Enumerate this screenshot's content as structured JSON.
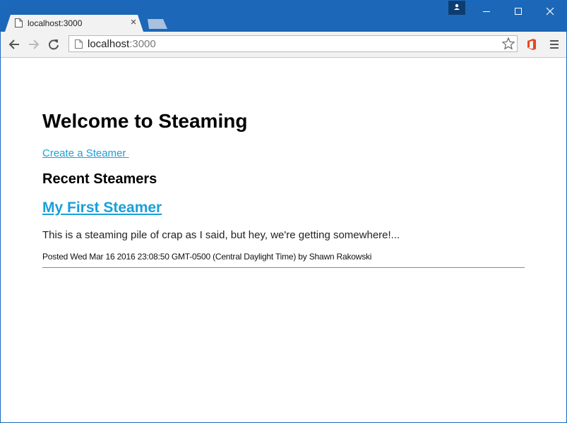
{
  "browser": {
    "tab_title": "localhost:3000",
    "tab_close": "×",
    "url_host": "localhost",
    "url_port": ":3000"
  },
  "page": {
    "title": "Welcome to Steaming",
    "create_link": "Create a Steamer ",
    "section_title": "Recent Steamers",
    "posts": [
      {
        "title": "My First Steamer",
        "body": "This is a steaming pile of crap as I said, but hey, we're getting somewhere!...",
        "meta": "Posted Wed Mar 16 2016 23:08:50 GMT-0500 (Central Daylight Time) by Shawn Rakowski"
      }
    ]
  },
  "colors": {
    "titlebar": "#1c67b7",
    "link": "#1aa0d8"
  },
  "icons": {
    "tab": "page-icon",
    "profile": "person-icon",
    "minimize": "minimize-icon",
    "maximize": "maximize-icon",
    "close": "close-icon",
    "back": "back-arrow-icon",
    "forward": "forward-arrow-icon",
    "reload": "reload-icon",
    "bookmark": "star-icon",
    "extension": "office-icon",
    "menu": "hamburger-menu-icon"
  }
}
